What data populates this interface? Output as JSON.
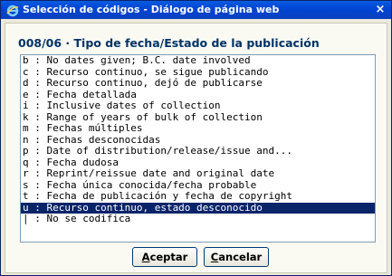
{
  "window": {
    "title": "Selección de códigos - Diálogo de página web",
    "close_label": "×"
  },
  "heading": "008/06 · Tipo de fecha/Estado de la publicación",
  "list": {
    "selected_index": 13,
    "items": [
      "b : No dates given; B.C. date involved",
      "c : Recurso continuo, se sigue publicando",
      "d : Recurso continuo, dejó de publicarse",
      "e : Fecha detallada",
      "i : Inclusive dates of collection",
      "k : Range of years of bulk of collection",
      "m : Fechas múltiples",
      "n : Fechas desconocidas",
      "p : Date of distribution/release/issue and...",
      "q : Fecha dudosa",
      "r : Reprint/reissue date and original date",
      "s : Fecha única conocida/fecha probable",
      "t : Fecha de publicación y fecha de copyright",
      "u : Recurso continuo, estado desconocido",
      "| : No se codifica"
    ]
  },
  "buttons": {
    "accept": {
      "mnemonic": "A",
      "rest": "ceptar"
    },
    "cancel": {
      "mnemonic": "C",
      "rest": "ancelar"
    }
  },
  "colors": {
    "title_bar": "#0046d5",
    "selection": "#0a246a",
    "heading": "#003366"
  }
}
